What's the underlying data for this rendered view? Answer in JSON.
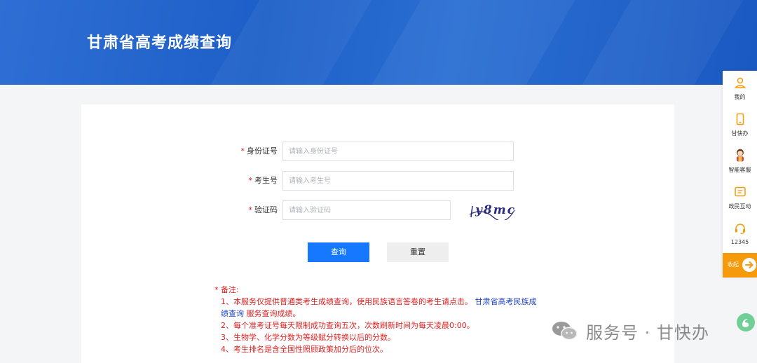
{
  "header": {
    "title": "甘肃省高考成绩查询"
  },
  "form": {
    "id_card": {
      "label": "身份证号",
      "placeholder": "请输入身份证号",
      "value": ""
    },
    "exam_no": {
      "label": "考生号",
      "placeholder": "请输入考生号",
      "value": ""
    },
    "captcha": {
      "label": "验证码",
      "placeholder": "请输入验证码",
      "value": "",
      "image_text": "y8mc"
    },
    "required_mark": "*",
    "query_button": "查询",
    "reset_button": "重置"
  },
  "notes": {
    "heading": "备注:",
    "item1_prefix": "1、本服务仅提供普通类考生成绩查询，使用民族语言答卷的考生请点击。",
    "item1_link_a": "甘肃省高考民族成",
    "item1_link_b": "绩查询",
    "item1_suffix": " 服务查询成绩。",
    "item2": "2、每个准考证号每天限制成功查询五次，次数刷新时间为每天凌晨0:00。",
    "item3": "3、生物学、化学分数为等级赋分转换以后的分数。",
    "item4": "4、考生排名是含全国性照顾政策加分后的位次。"
  },
  "sidebar": {
    "items": [
      {
        "label": "我的",
        "icon": "user-icon"
      },
      {
        "label": "甘快办",
        "icon": "phone-icon"
      },
      {
        "label": "智能客服",
        "icon": "assistant-avatar-icon"
      },
      {
        "label": "政民互动",
        "icon": "message-icon"
      },
      {
        "label": "12345",
        "icon": "headset-icon"
      }
    ],
    "fold_label": "收起"
  },
  "watermark": {
    "text": "服务号 · 甘快办"
  },
  "colors": {
    "primary": "#1677ff",
    "banner": "#1d5fc8",
    "accent": "#f59a0c",
    "required": "#e02020",
    "link": "#1d44c8"
  }
}
